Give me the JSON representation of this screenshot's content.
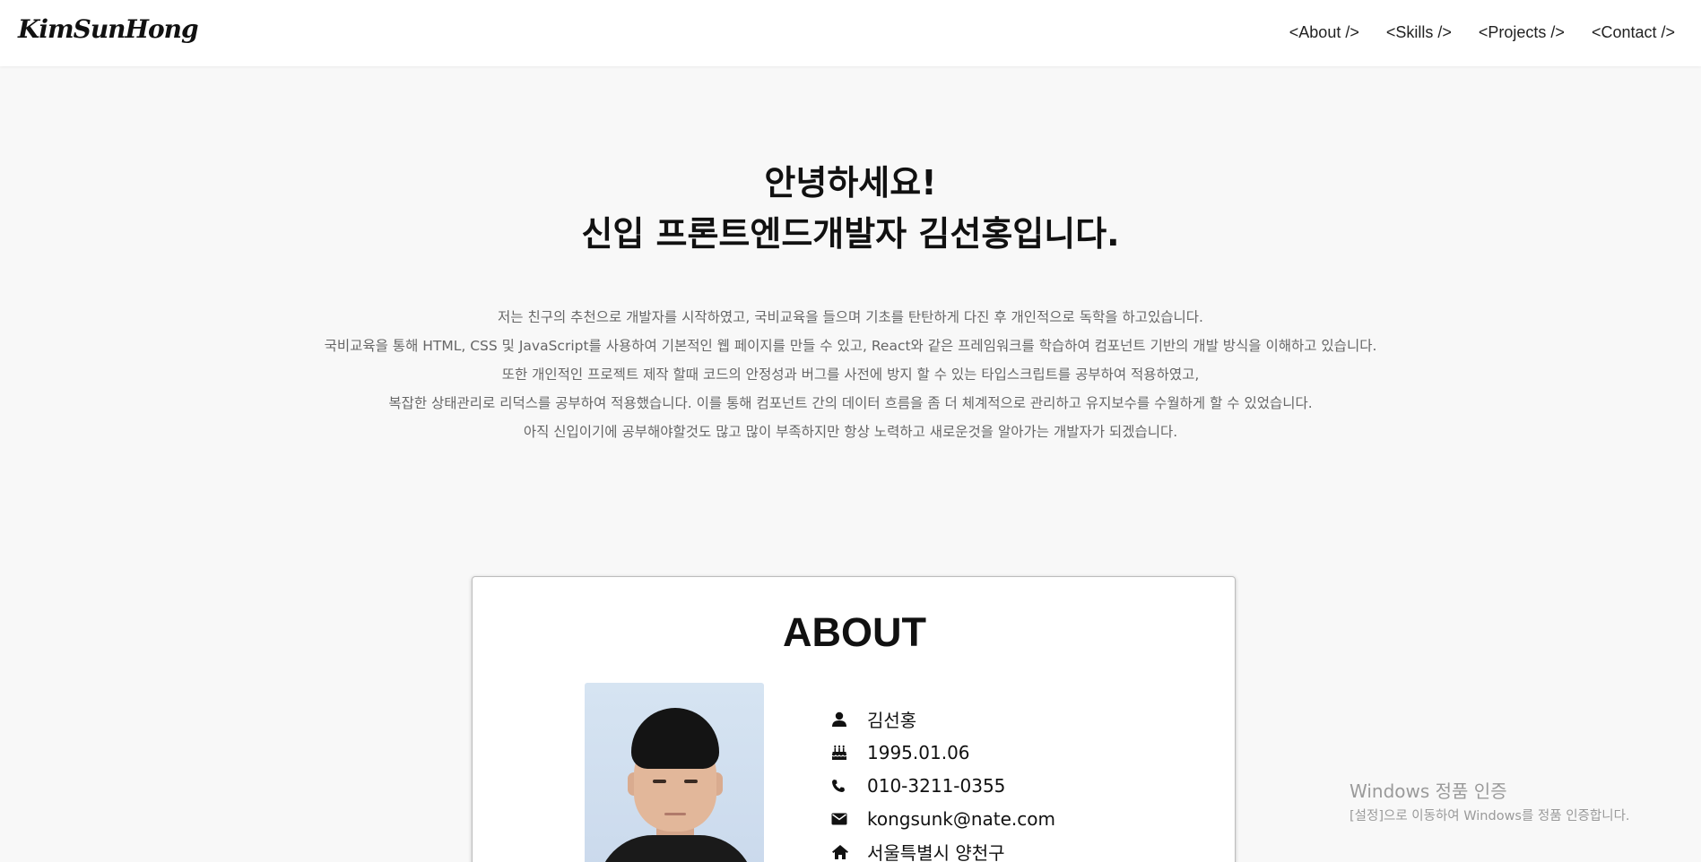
{
  "header": {
    "logo": "KimSunHong",
    "nav": [
      "<About />",
      "<Skills />",
      "<Projects />",
      "<Contact />"
    ]
  },
  "hero": {
    "title_line1": "안녕하세요!",
    "title_line2": "신입 프론트엔드개발자 김선홍입니다.",
    "description": [
      "저는 친구의 추천으로 개발자를 시작하였고, 국비교육을 들으며 기초를 탄탄하게 다진 후 개인적으로 독학을 하고있습니다.",
      "국비교육을 통해 HTML, CSS 및 JavaScript를 사용하여 기본적인 웹 페이지를 만들 수 있고, React와 같은 프레임워크를 학습하여 컴포넌트 기반의 개발 방식을 이해하고 있습니다.",
      "또한 개인적인 프로젝트 제작 할때 코드의 안정성과 버그를 사전에 방지 할 수 있는 타입스크립트를 공부하여 적용하였고,",
      "복잡한 상태관리로 리덕스를 공부하여 적용했습니다. 이를 통해 컴포넌트 간의 데이터 흐름을 좀 더 체계적으로 관리하고 유지보수를 수월하게 할 수 있었습니다.",
      "아직 신입이기에 공부해야할것도 많고 많이 부족하지만 항상 노력하고 새로운것을 알아가는 개발자가 되겠습니다."
    ]
  },
  "about": {
    "title": "ABOUT",
    "info": [
      {
        "icon": "user-icon",
        "text": "김선홍"
      },
      {
        "icon": "birthday-cake-icon",
        "text": "1995.01.06"
      },
      {
        "icon": "phone-icon",
        "text": "010-3211-0355"
      },
      {
        "icon": "mail-icon",
        "text": "kongsunk@nate.com"
      },
      {
        "icon": "home-icon",
        "text": "서울특별시 양천구"
      }
    ]
  },
  "watermark": {
    "title": "Windows 정품 인증",
    "subtitle": "[설정]으로 이동하여 Windows를 정품 인증합니다."
  }
}
